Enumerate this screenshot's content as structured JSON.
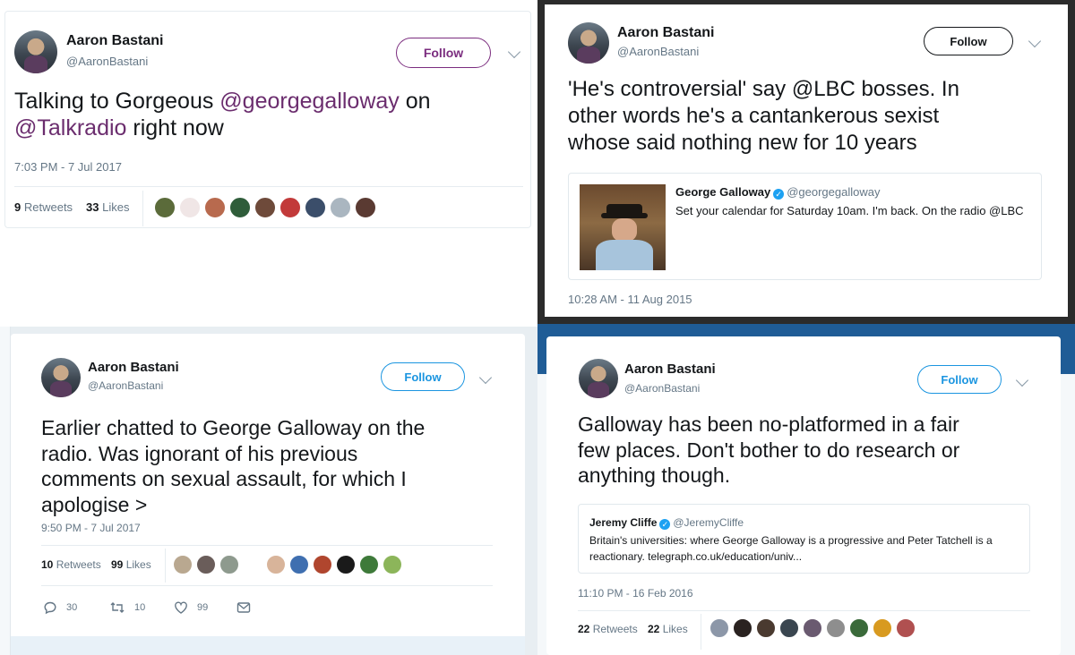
{
  "tweets": [
    {
      "author_name": "Aaron Bastani",
      "author_handle": "@AaronBastani",
      "follow_label": "Follow",
      "text_parts": [
        "Talking to Gorgeous ",
        "@georgegalloway",
        " on ",
        "@Talkradio",
        " right now"
      ],
      "timestamp": "7:03 PM - 7 Jul 2017",
      "retweets_count": "9",
      "retweets_label": "Retweets",
      "likes_count": "33",
      "likes_label": "Likes"
    },
    {
      "author_name": "Aaron Bastani",
      "author_handle": "@AaronBastani",
      "follow_label": "Follow",
      "text_lines": [
        "'He's controversial' say @LBC bosses. In",
        "other words he's a cantankerous sexist",
        "whose said nothing new for 10 years"
      ],
      "quote_name": "George Galloway",
      "quote_handle": "@georgegalloway",
      "quote_text": "Set your calendar for Saturday 10am. I'm back. On the radio @LBC",
      "timestamp": "10:28 AM - 11 Aug 2015"
    },
    {
      "author_name": "Aaron Bastani",
      "author_handle": "@AaronBastani",
      "follow_label": "Follow",
      "text_lines": [
        "Earlier chatted to George Galloway on the",
        "radio. Was ignorant of his previous",
        "comments on sexual assault, for which I",
        "apologise >"
      ],
      "timestamp": "9:50 PM - 7 Jul 2017",
      "retweets_count": "10",
      "retweets_label": "Retweets",
      "likes_count": "99",
      "likes_label": "Likes",
      "reply_count": "30",
      "retweet_action_count": "10",
      "like_action_count": "99"
    },
    {
      "author_name": "Aaron Bastani",
      "author_handle": "@AaronBastani",
      "follow_label": "Follow",
      "text_lines": [
        "Galloway has been no-platformed in a fair",
        "few places. Don't bother to do research or",
        "anything though."
      ],
      "quote_name": "Jeremy Cliffe",
      "quote_handle": "@JeremyCliffe",
      "quote_lines": [
        "Britain's universities: where George Galloway is a progressive and Peter Tatchell is a",
        "reactionary. telegraph.co.uk/education/univ..."
      ],
      "timestamp": "11:10 PM - 16 Feb 2016",
      "retweets_count": "22",
      "retweets_label": "Retweets",
      "likes_count": "22",
      "likes_label": "Likes"
    }
  ],
  "colors": {
    "link_purple": "#6b2d6e",
    "follow_purple": "#7b2d7f",
    "follow_blue": "#1b95e0",
    "text_dark": "#14171a",
    "muted": "#657786",
    "dark_frame": "#2b2b2b"
  },
  "icons": [
    "reply-icon",
    "retweet-icon",
    "heart-icon",
    "mail-icon",
    "chevron-down-icon",
    "verified-icon"
  ]
}
